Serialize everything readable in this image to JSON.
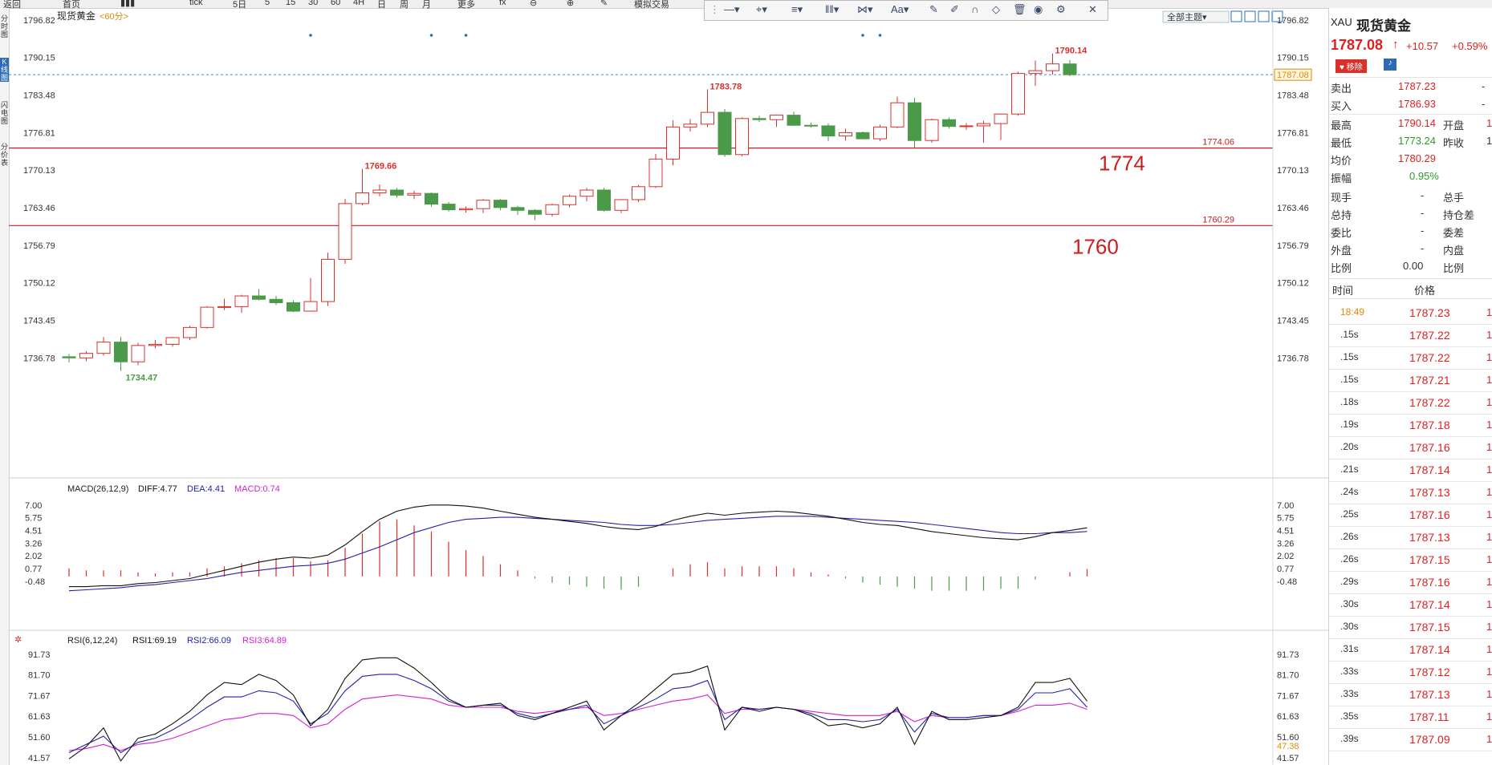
{
  "toolbar": {
    "items": [
      "返回",
      "首页",
      "",
      "tick",
      "5日",
      "5",
      "15",
      "30",
      "60",
      "4H",
      "日",
      "周",
      "月",
      "更多",
      "",
      "模拟交易"
    ],
    "draw_tools": [
      "—▾",
      "⌖▾",
      "≡▾",
      "‖‖▾",
      "⋈▾",
      "Aa▾",
      "✎",
      "✐",
      "∩",
      "◇",
      "🗑",
      "◉",
      "⚙",
      "✕"
    ]
  },
  "left_tabs": [
    "分时图",
    "K线图",
    "闪电图",
    "分价表"
  ],
  "chart": {
    "instrument_label": "现货黄金",
    "period_label": "<60分>",
    "theme_button": "全部主题▾",
    "current_price_tag": "1787.08",
    "colors": {
      "up": "#d9302c",
      "down": "#4a9a4a",
      "level": "#c81e1e",
      "macd_diff": "#111111",
      "macd_dea": "#2222aa",
      "rsi1": "#111111",
      "rsi2": "#2222aa",
      "rsi3": "#d21fd2"
    }
  },
  "chart_data": [
    {
      "type": "candlestick",
      "title": "现货黄金 <60分>",
      "y_ticks": [
        "1796.82",
        "1790.15",
        "1783.48",
        "1776.81",
        "1770.13",
        "1763.46",
        "1756.79",
        "1750.12",
        "1743.45",
        "1736.78"
      ],
      "ylim": [
        1732.0,
        1797.5
      ],
      "candles": [
        [
          1737.0,
          1737.5,
          1736.0,
          1736.8
        ],
        [
          1736.8,
          1738.0,
          1736.2,
          1737.6
        ],
        [
          1737.6,
          1740.5,
          1737.2,
          1739.6
        ],
        [
          1739.6,
          1740.5,
          1734.47,
          1736.1
        ],
        [
          1736.1,
          1739.5,
          1735.5,
          1739.0
        ],
        [
          1739.0,
          1740.0,
          1738.5,
          1739.2
        ],
        [
          1739.2,
          1740.5,
          1738.8,
          1740.4
        ],
        [
          1740.4,
          1742.5,
          1740.0,
          1742.2
        ],
        [
          1742.2,
          1746.0,
          1742.0,
          1745.8
        ],
        [
          1745.8,
          1747.3,
          1745.3,
          1745.9
        ],
        [
          1745.9,
          1748.0,
          1744.8,
          1747.8
        ],
        [
          1747.8,
          1749.0,
          1747.0,
          1747.2
        ],
        [
          1747.2,
          1747.8,
          1746.2,
          1746.6
        ],
        [
          1746.6,
          1747.0,
          1744.9,
          1745.1
        ],
        [
          1745.1,
          1751.0,
          1745.0,
          1746.8
        ],
        [
          1746.8,
          1755.5,
          1746.0,
          1754.3
        ],
        [
          1754.3,
          1765.0,
          1753.5,
          1764.2
        ],
        [
          1764.2,
          1769.66,
          1763.9,
          1766.1
        ],
        [
          1766.1,
          1767.6,
          1765.5,
          1766.6
        ],
        [
          1766.6,
          1767.0,
          1765.3,
          1765.7
        ],
        [
          1765.7,
          1766.5,
          1765.0,
          1766.0
        ],
        [
          1766.0,
          1766.2,
          1763.6,
          1764.1
        ],
        [
          1764.1,
          1764.5,
          1762.8,
          1763.1
        ],
        [
          1763.1,
          1763.7,
          1762.6,
          1763.3
        ],
        [
          1763.3,
          1765.0,
          1762.5,
          1764.8
        ],
        [
          1764.8,
          1765.0,
          1763.0,
          1763.5
        ],
        [
          1763.5,
          1763.8,
          1762.2,
          1763.0
        ],
        [
          1763.0,
          1763.2,
          1761.2,
          1762.3
        ],
        [
          1762.3,
          1764.2,
          1761.9,
          1764.0
        ],
        [
          1764.0,
          1765.8,
          1763.5,
          1765.5
        ],
        [
          1765.5,
          1767.0,
          1764.6,
          1766.6
        ],
        [
          1766.6,
          1767.0,
          1762.8,
          1763.0
        ],
        [
          1763.0,
          1765.0,
          1762.5,
          1764.9
        ],
        [
          1764.9,
          1767.5,
          1764.5,
          1767.2
        ],
        [
          1767.2,
          1773.0,
          1767.0,
          1772.1
        ],
        [
          1772.1,
          1779.0,
          1771.0,
          1777.8
        ],
        [
          1777.8,
          1779.2,
          1777.0,
          1778.3
        ],
        [
          1778.3,
          1783.78,
          1777.8,
          1780.4
        ],
        [
          1780.4,
          1781.0,
          1772.5,
          1772.9
        ],
        [
          1772.9,
          1779.5,
          1772.6,
          1779.3
        ],
        [
          1779.3,
          1779.8,
          1778.7,
          1779.1
        ],
        [
          1779.1,
          1780.0,
          1777.8,
          1779.9
        ],
        [
          1779.9,
          1780.5,
          1778.0,
          1778.1
        ],
        [
          1778.1,
          1778.6,
          1777.7,
          1778.0
        ],
        [
          1778.0,
          1778.4,
          1775.3,
          1776.2
        ],
        [
          1776.2,
          1777.5,
          1775.4,
          1776.8
        ],
        [
          1776.8,
          1777.0,
          1775.6,
          1775.7
        ],
        [
          1775.7,
          1778.2,
          1775.3,
          1777.8
        ],
        [
          1777.8,
          1783.2,
          1777.6,
          1782.1
        ],
        [
          1782.1,
          1783.0,
          1774.06,
          1775.4
        ],
        [
          1775.4,
          1779.3,
          1775.0,
          1779.1
        ],
        [
          1779.1,
          1779.5,
          1777.5,
          1777.9
        ],
        [
          1777.9,
          1778.5,
          1777.3,
          1778.0
        ],
        [
          1778.0,
          1778.9,
          1775.0,
          1778.4
        ],
        [
          1778.4,
          1780.2,
          1775.5,
          1780.1
        ],
        [
          1780.1,
          1787.6,
          1779.8,
          1787.3
        ],
        [
          1787.3,
          1789.6,
          1785.1,
          1787.8
        ],
        [
          1787.8,
          1790.14,
          1787.1,
          1789.0
        ],
        [
          1789.0,
          1789.7,
          1786.8,
          1787.08
        ]
      ],
      "high_annotations": [
        {
          "index": 17,
          "label": "1769.66"
        },
        {
          "index": 37,
          "label": "1783.78"
        },
        {
          "index": 57,
          "label": "1790.14"
        }
      ],
      "low_annotation": {
        "index": 3,
        "label": "1734.47"
      },
      "levels": [
        {
          "value": 1774.06,
          "label": "1774.06",
          "big_label": "1774"
        },
        {
          "value": 1760.29,
          "label": "1760.29",
          "big_label": "1760"
        }
      ],
      "current_price": 1787.08,
      "signal_dots": [
        14,
        21,
        23,
        46,
        47
      ]
    },
    {
      "type": "macd",
      "title": "MACD(26,12,9)",
      "diff_label": "DIFF:4.77",
      "dea_label": "DEA:4.41",
      "macd_label": "MACD:0.74",
      "y_ticks": [
        "7.00",
        "5.75",
        "4.51",
        "3.26",
        "2.02",
        "0.77",
        "-0.48"
      ],
      "ylim": [
        -1.5,
        7.3
      ],
      "diff": [
        -1.0,
        -1.0,
        -0.9,
        -0.9,
        -0.7,
        -0.6,
        -0.4,
        -0.2,
        0.2,
        0.6,
        1.0,
        1.4,
        1.7,
        1.9,
        1.8,
        2.1,
        3.1,
        4.4,
        5.6,
        6.4,
        6.8,
        7.0,
        7.0,
        6.9,
        6.7,
        6.4,
        6.1,
        5.8,
        5.6,
        5.4,
        5.2,
        4.9,
        4.7,
        4.6,
        4.9,
        5.5,
        5.9,
        6.2,
        6.0,
        6.2,
        6.3,
        6.4,
        6.3,
        6.1,
        5.9,
        5.6,
        5.3,
        5.1,
        5.0,
        4.7,
        4.4,
        4.2,
        4.0,
        3.8,
        3.7,
        3.6,
        3.9,
        4.3,
        4.5,
        4.77
      ],
      "dea": [
        -1.4,
        -1.3,
        -1.2,
        -1.1,
        -0.9,
        -0.8,
        -0.6,
        -0.4,
        -0.2,
        0.1,
        0.4,
        0.6,
        0.8,
        1.0,
        1.1,
        1.3,
        1.7,
        2.3,
        2.9,
        3.6,
        4.3,
        4.8,
        5.3,
        5.6,
        5.7,
        5.8,
        5.8,
        5.7,
        5.6,
        5.5,
        5.4,
        5.3,
        5.1,
        5.0,
        5.0,
        5.1,
        5.3,
        5.5,
        5.6,
        5.7,
        5.8,
        5.9,
        5.9,
        5.9,
        5.8,
        5.7,
        5.6,
        5.5,
        5.4,
        5.3,
        5.1,
        4.9,
        4.7,
        4.5,
        4.3,
        4.2,
        4.2,
        4.3,
        4.3,
        4.41
      ],
      "macd": [
        0.8,
        0.6,
        0.6,
        0.6,
        0.4,
        0.3,
        0.4,
        0.4,
        0.8,
        1.0,
        1.3,
        1.6,
        1.8,
        1.8,
        1.5,
        1.6,
        2.8,
        4.2,
        5.4,
        5.6,
        5.0,
        4.4,
        3.4,
        2.6,
        2.0,
        1.2,
        0.6,
        -0.2,
        -0.6,
        -0.8,
        -1.0,
        -1.2,
        -1.3,
        -1.0,
        0.0,
        0.8,
        1.2,
        1.4,
        0.8,
        1.0,
        1.0,
        1.0,
        0.8,
        0.4,
        0.2,
        -0.2,
        -0.6,
        -0.8,
        -1.0,
        -1.2,
        -1.4,
        -1.4,
        -1.4,
        -1.4,
        -1.2,
        -1.2,
        -0.3,
        0.0,
        0.4,
        0.74
      ]
    },
    {
      "type": "rsi",
      "title": "RSI(6,12,24)",
      "rsi1_label": "RSI1:69.19",
      "rsi2_label": "RSI2:66.09",
      "rsi3_label": "RSI3:64.89",
      "y_ticks": [
        "91.73",
        "81.70",
        "71.67",
        "61.63",
        "51.60",
        "41.57"
      ],
      "extra_tick": "47.38",
      "ylim": [
        38,
        94
      ],
      "rsi1": [
        41,
        47,
        56,
        40,
        51,
        53,
        58,
        64,
        72,
        78,
        77,
        82,
        79,
        72,
        57,
        65,
        80,
        89,
        90,
        90,
        85,
        78,
        70,
        66,
        67,
        68,
        62,
        60,
        63,
        66,
        69,
        55,
        62,
        68,
        75,
        82,
        83,
        86,
        55,
        66,
        64,
        66,
        65,
        62,
        57,
        58,
        56,
        58,
        66,
        48,
        64,
        60,
        60,
        61,
        62,
        66,
        78,
        78,
        80,
        69
      ],
      "rsi2": [
        44,
        48,
        52,
        44,
        49,
        51,
        55,
        60,
        66,
        71,
        71,
        74,
        73,
        69,
        58,
        63,
        74,
        81,
        82,
        82,
        79,
        75,
        69,
        66,
        67,
        67,
        63,
        61,
        63,
        65,
        67,
        58,
        62,
        66,
        70,
        75,
        76,
        79,
        60,
        66,
        65,
        66,
        65,
        63,
        60,
        60,
        59,
        60,
        65,
        54,
        63,
        61,
        61,
        62,
        62,
        65,
        73,
        73,
        75,
        66
      ],
      "rsi3": [
        45,
        46,
        48,
        45,
        48,
        49,
        51,
        54,
        57,
        60,
        61,
        63,
        63,
        62,
        56,
        58,
        65,
        70,
        71,
        72,
        71,
        70,
        67,
        66,
        66,
        66,
        64,
        63,
        64,
        65,
        66,
        62,
        63,
        65,
        67,
        69,
        70,
        72,
        63,
        65,
        65,
        66,
        65,
        64,
        63,
        62,
        62,
        62,
        64,
        59,
        62,
        61,
        61,
        62,
        62,
        64,
        67,
        67,
        68,
        65
      ]
    }
  ],
  "quote_panel": {
    "code": "XAU",
    "name": "现货黄金",
    "price": "1787.08",
    "arrow": "↑",
    "change": "+10.57",
    "change_pct": "+0.59%",
    "remove_button": "♥ 移除",
    "alert_icon": "bell-icon",
    "sell_label": "卖出",
    "sell_value": "1787.23",
    "sell_vol": "-",
    "buy_label": "买入",
    "buy_value": "1786.93",
    "buy_vol": "-",
    "high_label": "最高",
    "high_value": "1790.14",
    "open_label": "开盘",
    "open_value": "1",
    "low_label": "最低",
    "low_value": "1773.24",
    "prev_label": "昨收",
    "prev_value": "1",
    "avg_label": "均价",
    "avg_value": "1780.29",
    "amp_label": "振幅",
    "amp_value": "0.95%",
    "xianshou_label": "现手",
    "xianshou_value": "-",
    "zongshou_label": "总手",
    "zongchi_label": "总持",
    "zongchi_value": "-",
    "chicangcha_label": "持仓差",
    "weibi_label": "委比",
    "weibi_value": "-",
    "weicha_label": "委差",
    "waipan_label": "外盘",
    "waipan_value": "-",
    "neipan_label": "内盘",
    "bili_label": "比例",
    "bili_value": "0.00",
    "bili2_label": "比例",
    "tick_header_time": "时间",
    "tick_header_price": "价格",
    "ticks": [
      {
        "time": "18:49",
        "price": "1787.23",
        "vol": "1"
      },
      {
        "time": ".15s",
        "price": "1787.22",
        "vol": "1"
      },
      {
        "time": ".15s",
        "price": "1787.22",
        "vol": "1"
      },
      {
        "time": ".15s",
        "price": "1787.21",
        "vol": "1"
      },
      {
        "time": ".18s",
        "price": "1787.22",
        "vol": "1"
      },
      {
        "time": ".19s",
        "price": "1787.18",
        "vol": "1"
      },
      {
        "time": ".20s",
        "price": "1787.16",
        "vol": "1"
      },
      {
        "time": ".21s",
        "price": "1787.14",
        "vol": "1"
      },
      {
        "time": ".24s",
        "price": "1787.13",
        "vol": "1"
      },
      {
        "time": ".25s",
        "price": "1787.16",
        "vol": "1"
      },
      {
        "time": ".26s",
        "price": "1787.13",
        "vol": "1"
      },
      {
        "time": ".26s",
        "price": "1787.15",
        "vol": "1"
      },
      {
        "time": ".29s",
        "price": "1787.16",
        "vol": "1"
      },
      {
        "time": ".30s",
        "price": "1787.14",
        "vol": "1"
      },
      {
        "time": ".30s",
        "price": "1787.15",
        "vol": "1"
      },
      {
        "time": ".31s",
        "price": "1787.14",
        "vol": "1"
      },
      {
        "time": ".33s",
        "price": "1787.12",
        "vol": "1"
      },
      {
        "time": ".33s",
        "price": "1787.13",
        "vol": "1"
      },
      {
        "time": ".35s",
        "price": "1787.11",
        "vol": "1"
      },
      {
        "time": ".39s",
        "price": "1787.09",
        "vol": "1"
      }
    ]
  }
}
